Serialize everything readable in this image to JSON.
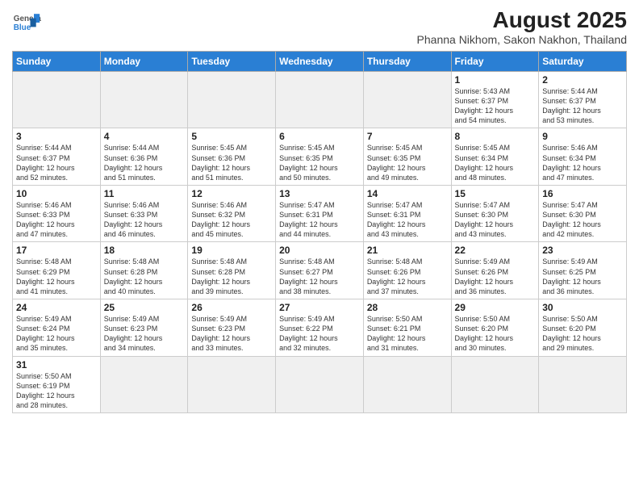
{
  "logo": {
    "line1": "General",
    "line2": "Blue"
  },
  "title": "August 2025",
  "subtitle": "Phanna Nikhom, Sakon Nakhon, Thailand",
  "weekdays": [
    "Sunday",
    "Monday",
    "Tuesday",
    "Wednesday",
    "Thursday",
    "Friday",
    "Saturday"
  ],
  "weeks": [
    [
      {
        "day": "",
        "info": ""
      },
      {
        "day": "",
        "info": ""
      },
      {
        "day": "",
        "info": ""
      },
      {
        "day": "",
        "info": ""
      },
      {
        "day": "",
        "info": ""
      },
      {
        "day": "1",
        "info": "Sunrise: 5:43 AM\nSunset: 6:37 PM\nDaylight: 12 hours\nand 54 minutes."
      },
      {
        "day": "2",
        "info": "Sunrise: 5:44 AM\nSunset: 6:37 PM\nDaylight: 12 hours\nand 53 minutes."
      }
    ],
    [
      {
        "day": "3",
        "info": "Sunrise: 5:44 AM\nSunset: 6:37 PM\nDaylight: 12 hours\nand 52 minutes."
      },
      {
        "day": "4",
        "info": "Sunrise: 5:44 AM\nSunset: 6:36 PM\nDaylight: 12 hours\nand 51 minutes."
      },
      {
        "day": "5",
        "info": "Sunrise: 5:45 AM\nSunset: 6:36 PM\nDaylight: 12 hours\nand 51 minutes."
      },
      {
        "day": "6",
        "info": "Sunrise: 5:45 AM\nSunset: 6:35 PM\nDaylight: 12 hours\nand 50 minutes."
      },
      {
        "day": "7",
        "info": "Sunrise: 5:45 AM\nSunset: 6:35 PM\nDaylight: 12 hours\nand 49 minutes."
      },
      {
        "day": "8",
        "info": "Sunrise: 5:45 AM\nSunset: 6:34 PM\nDaylight: 12 hours\nand 48 minutes."
      },
      {
        "day": "9",
        "info": "Sunrise: 5:46 AM\nSunset: 6:34 PM\nDaylight: 12 hours\nand 47 minutes."
      }
    ],
    [
      {
        "day": "10",
        "info": "Sunrise: 5:46 AM\nSunset: 6:33 PM\nDaylight: 12 hours\nand 47 minutes."
      },
      {
        "day": "11",
        "info": "Sunrise: 5:46 AM\nSunset: 6:33 PM\nDaylight: 12 hours\nand 46 minutes."
      },
      {
        "day": "12",
        "info": "Sunrise: 5:46 AM\nSunset: 6:32 PM\nDaylight: 12 hours\nand 45 minutes."
      },
      {
        "day": "13",
        "info": "Sunrise: 5:47 AM\nSunset: 6:31 PM\nDaylight: 12 hours\nand 44 minutes."
      },
      {
        "day": "14",
        "info": "Sunrise: 5:47 AM\nSunset: 6:31 PM\nDaylight: 12 hours\nand 43 minutes."
      },
      {
        "day": "15",
        "info": "Sunrise: 5:47 AM\nSunset: 6:30 PM\nDaylight: 12 hours\nand 43 minutes."
      },
      {
        "day": "16",
        "info": "Sunrise: 5:47 AM\nSunset: 6:30 PM\nDaylight: 12 hours\nand 42 minutes."
      }
    ],
    [
      {
        "day": "17",
        "info": "Sunrise: 5:48 AM\nSunset: 6:29 PM\nDaylight: 12 hours\nand 41 minutes."
      },
      {
        "day": "18",
        "info": "Sunrise: 5:48 AM\nSunset: 6:28 PM\nDaylight: 12 hours\nand 40 minutes."
      },
      {
        "day": "19",
        "info": "Sunrise: 5:48 AM\nSunset: 6:28 PM\nDaylight: 12 hours\nand 39 minutes."
      },
      {
        "day": "20",
        "info": "Sunrise: 5:48 AM\nSunset: 6:27 PM\nDaylight: 12 hours\nand 38 minutes."
      },
      {
        "day": "21",
        "info": "Sunrise: 5:48 AM\nSunset: 6:26 PM\nDaylight: 12 hours\nand 37 minutes."
      },
      {
        "day": "22",
        "info": "Sunrise: 5:49 AM\nSunset: 6:26 PM\nDaylight: 12 hours\nand 36 minutes."
      },
      {
        "day": "23",
        "info": "Sunrise: 5:49 AM\nSunset: 6:25 PM\nDaylight: 12 hours\nand 36 minutes."
      }
    ],
    [
      {
        "day": "24",
        "info": "Sunrise: 5:49 AM\nSunset: 6:24 PM\nDaylight: 12 hours\nand 35 minutes."
      },
      {
        "day": "25",
        "info": "Sunrise: 5:49 AM\nSunset: 6:23 PM\nDaylight: 12 hours\nand 34 minutes."
      },
      {
        "day": "26",
        "info": "Sunrise: 5:49 AM\nSunset: 6:23 PM\nDaylight: 12 hours\nand 33 minutes."
      },
      {
        "day": "27",
        "info": "Sunrise: 5:49 AM\nSunset: 6:22 PM\nDaylight: 12 hours\nand 32 minutes."
      },
      {
        "day": "28",
        "info": "Sunrise: 5:50 AM\nSunset: 6:21 PM\nDaylight: 12 hours\nand 31 minutes."
      },
      {
        "day": "29",
        "info": "Sunrise: 5:50 AM\nSunset: 6:20 PM\nDaylight: 12 hours\nand 30 minutes."
      },
      {
        "day": "30",
        "info": "Sunrise: 5:50 AM\nSunset: 6:20 PM\nDaylight: 12 hours\nand 29 minutes."
      }
    ],
    [
      {
        "day": "31",
        "info": "Sunrise: 5:50 AM\nSunset: 6:19 PM\nDaylight: 12 hours\nand 28 minutes."
      },
      {
        "day": "",
        "info": ""
      },
      {
        "day": "",
        "info": ""
      },
      {
        "day": "",
        "info": ""
      },
      {
        "day": "",
        "info": ""
      },
      {
        "day": "",
        "info": ""
      },
      {
        "day": "",
        "info": ""
      }
    ]
  ]
}
